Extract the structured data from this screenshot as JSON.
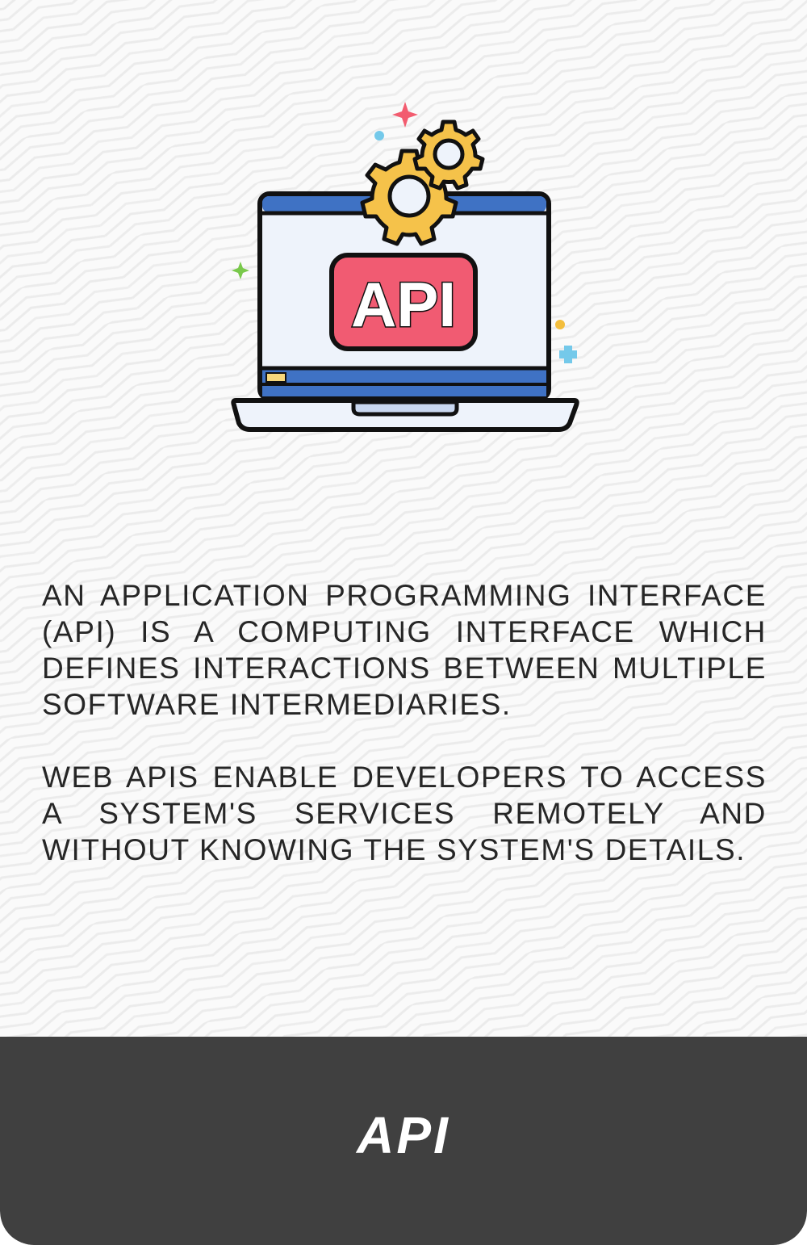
{
  "illustration": {
    "icon": "laptop-api-gears-icon",
    "screen_label": "API",
    "colors": {
      "outline": "#111111",
      "screen": "#eef3fb",
      "screen_bar": "#3f72c4",
      "badge": "#f15b72",
      "gear": "#f5c24a",
      "sparkle_red": "#f25c6f",
      "sparkle_green": "#79c94b",
      "dot_blue": "#74c9ea",
      "dot_yellow": "#f3be3d"
    }
  },
  "description": {
    "paragraph_1": "AN APPLICATION PROGRAMMING INTERFACE (API) IS A COMPUTING INTERFACE WHICH DEFINES INTERACTIONS BETWEEN MULTIPLE SOFTWARE INTERMEDIARIES.",
    "paragraph_2": "WEB APIS ENABLE DEVELOPERS TO ACCESS A SYSTEM'S SERVICES REMOTELY AND WITHOUT KNOWING THE SYSTEM'S DETAILS."
  },
  "footer": {
    "title": "API",
    "background": "#404040"
  },
  "theme": {
    "card_background": "#fafafa",
    "text_color": "#262626"
  }
}
